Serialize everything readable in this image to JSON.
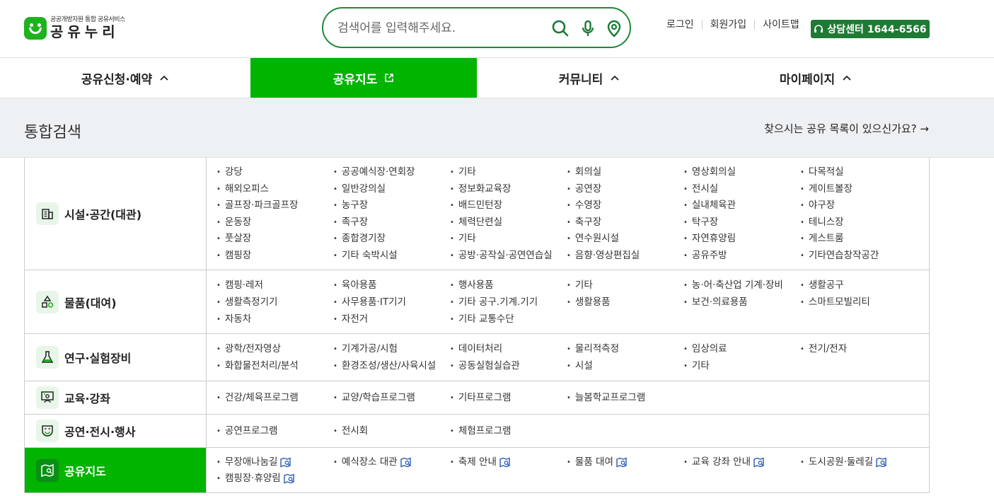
{
  "header": {
    "logo_sub": "공공개방자원 통합 공유서비스",
    "logo_main": "공유누리",
    "search_placeholder": "검색어를 입력해주세요.",
    "util_links": [
      "로그인",
      "회원가입",
      "사이트맵"
    ],
    "callcenter": "상담센터 1644-6566"
  },
  "nav": [
    {
      "label": "공유신청·예약",
      "icon": "chevron-up-icon"
    },
    {
      "label": "공유지도",
      "icon": "external-link-icon",
      "active": true
    },
    {
      "label": "커뮤니티",
      "icon": "chevron-up-icon"
    },
    {
      "label": "마이페이지",
      "icon": "chevron-up-icon"
    }
  ],
  "band": {
    "title": "통합검색",
    "link": "찾으시는 공유 목록이 있으신가요? →"
  },
  "categories": [
    {
      "name": "시설·공간(대관)",
      "icon": "building-icon",
      "items": [
        "강당",
        "공공예식장·연회장",
        "기타",
        "회의실",
        "영상회의실",
        "다목적실",
        "해외오피스",
        "일반강의실",
        "정보화교육장",
        "공연장",
        "전시실",
        "게이트볼장",
        "골프장·파크골프장",
        "농구장",
        "배드민턴장",
        "수영장",
        "실내체육관",
        "야구장",
        "운동장",
        "족구장",
        "체력단련실",
        "축구장",
        "탁구장",
        "테니스장",
        "풋살장",
        "종합경기장",
        "기타",
        "연수원시설",
        "자연휴양림",
        "게스트룸",
        "캠핑장",
        "기타 숙박시설",
        "공방·공작실·공연연습실",
        "음향·영상편집실",
        "공유주방",
        "기타연습창작공간"
      ]
    },
    {
      "name": "물품(대여)",
      "icon": "shapes-icon",
      "items": [
        "캠핑·레저",
        "육아용품",
        "행사용품",
        "기타",
        "농·어·축산업 기계·장비",
        "생활공구",
        "생활측정기기",
        "사무용품·IT기기",
        "기타 공구.기계.기기",
        "생활용품",
        "보건·의료용품",
        "스마트모빌리티",
        "자동차",
        "자전거",
        "기타 교통수단"
      ]
    },
    {
      "name": "연구·실험장비",
      "icon": "flask-icon",
      "items": [
        "광학/전자영상",
        "기계가공/시험",
        "데이터처리",
        "물리적측정",
        "임상의료",
        "전기/전자",
        "화합물전처리/분석",
        "환경조성/생산/사육시설",
        "공동실험실습관",
        "시설",
        "기타"
      ]
    },
    {
      "name": "교육·강좌",
      "icon": "presentation-icon",
      "items": [
        "건강/체육프로그램",
        "교양/학습프로그램",
        "기타프로그램",
        "늘봄학교프로그램"
      ]
    },
    {
      "name": "공연·전시·행사",
      "icon": "mask-icon",
      "items": [
        "공연프로그램",
        "전시회",
        "체험프로그램"
      ]
    },
    {
      "name": "공유지도",
      "icon": "map-icon",
      "highlight": true,
      "items": [
        "무장애나눔길",
        "예식장소 대관",
        "축제 안내",
        "물품 대여",
        "교육 강좌 안내",
        "도시공원·둘레길",
        "캠핑장·휴양림"
      ]
    }
  ]
}
